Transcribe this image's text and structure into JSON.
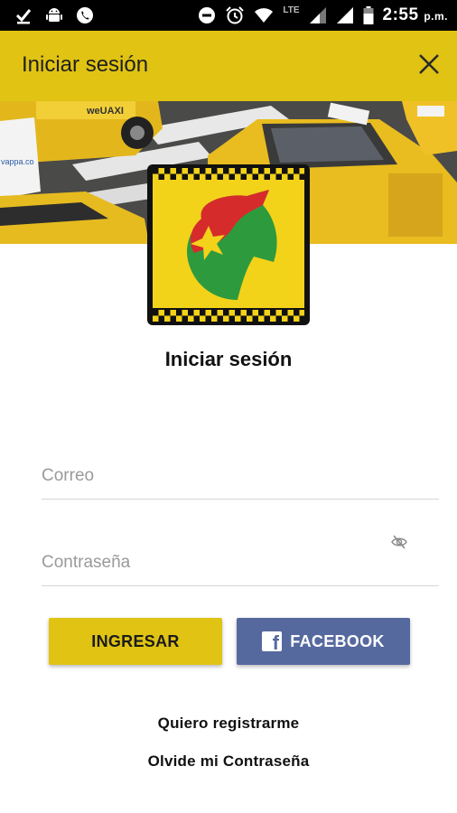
{
  "status_bar": {
    "network_label": "LTE",
    "time": "2:55",
    "time_suffix": "p.m."
  },
  "app_bar": {
    "title": "Iniciar sesión",
    "close_icon": "close-icon"
  },
  "hero": {
    "sign_text": "weUAXI",
    "sticker_text": "vappa.co"
  },
  "login": {
    "heading": "Iniciar sesión",
    "email_placeholder": "Correo",
    "password_placeholder": "Contraseña",
    "login_button": "INGRESAR",
    "facebook_button": "FACEBOOK",
    "register_link": "Quiero registrarme",
    "forgot_link": "Olvide mi Contraseña"
  },
  "colors": {
    "accent": "#e0c313",
    "facebook": "#56699f",
    "status_bar": "#000000"
  }
}
